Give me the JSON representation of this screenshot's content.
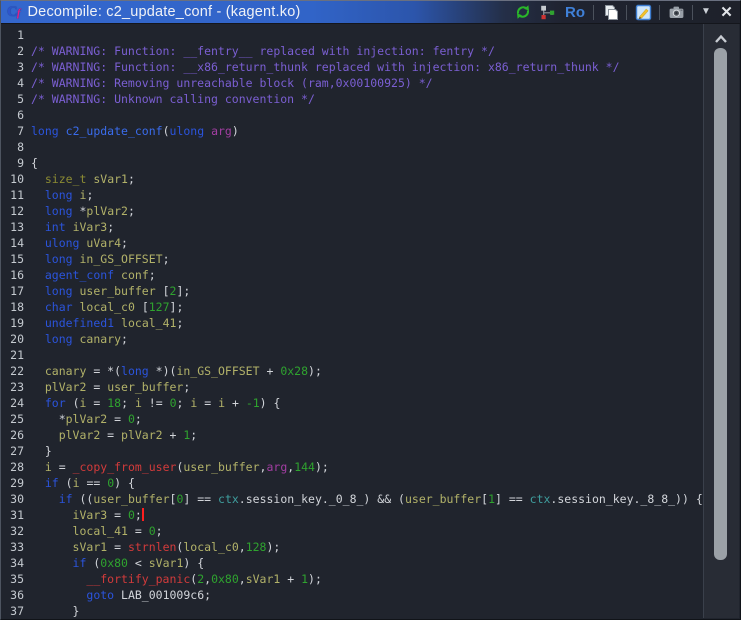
{
  "window": {
    "title": "Decompile: c2_update_conf - (kagent.ko)",
    "decompiler_icon": {
      "letter": "C",
      "sub": "f"
    },
    "toolbar": {
      "ro_label": "Ro",
      "dropdown_glyph": "▼",
      "close_glyph": "✕",
      "icons": [
        "refresh-icon",
        "graph-icon",
        "ro-label",
        "copy-icon",
        "edit-icon",
        "snapshot-icon",
        "dropdown-arrow-icon",
        "close-icon"
      ]
    }
  },
  "colors": {
    "titlebar_accent": "#3164c8",
    "editor_background": "#20242d",
    "comment": "#7b5fd3",
    "keyword_type": "#2b54dc",
    "function_name": "#3a6cec",
    "variable": "#b2b269",
    "constant": "#2fa32f",
    "parameter": "#a23ea2",
    "global": "#3f9f9f",
    "call": "#d23b3b",
    "caret": "#ff1f1f",
    "refresh_green": "#2ab62a"
  },
  "editor": {
    "lines": [
      {
        "n": "1",
        "seg": []
      },
      {
        "n": "2",
        "seg": [
          [
            "cm",
            "/* WARNING: Function: __fentry__ replaced with injection: fentry */"
          ]
        ]
      },
      {
        "n": "3",
        "seg": [
          [
            "cm",
            "/* WARNING: Function: __x86_return_thunk replaced with injection: x86_return_thunk */"
          ]
        ]
      },
      {
        "n": "4",
        "seg": [
          [
            "cm",
            "/* WARNING: Removing unreachable block (ram,0x00100925) */"
          ]
        ]
      },
      {
        "n": "5",
        "seg": [
          [
            "cm",
            "/* WARNING: Unknown calling convention */"
          ]
        ]
      },
      {
        "n": "6",
        "seg": []
      },
      {
        "n": "7",
        "seg": [
          [
            "kw",
            "long"
          ],
          [
            "df",
            " "
          ],
          [
            "fn",
            "c2_update_conf"
          ],
          [
            "df",
            "("
          ],
          [
            "kw",
            "ulong"
          ],
          [
            "df",
            " "
          ],
          [
            "par",
            "arg"
          ],
          [
            "df",
            ")"
          ]
        ]
      },
      {
        "n": "8",
        "seg": []
      },
      {
        "n": "9",
        "seg": [
          [
            "df",
            "{"
          ]
        ]
      },
      {
        "n": "10",
        "seg": [
          [
            "df",
            "  "
          ],
          [
            "t2",
            "size_t"
          ],
          [
            "df",
            " "
          ],
          [
            "var",
            "sVar1"
          ],
          [
            "df",
            ";"
          ]
        ]
      },
      {
        "n": "11",
        "seg": [
          [
            "df",
            "  "
          ],
          [
            "kw",
            "long"
          ],
          [
            "df",
            " "
          ],
          [
            "var",
            "i"
          ],
          [
            "df",
            ";"
          ]
        ]
      },
      {
        "n": "12",
        "seg": [
          [
            "df",
            "  "
          ],
          [
            "kw",
            "long"
          ],
          [
            "df",
            " *"
          ],
          [
            "var",
            "plVar2"
          ],
          [
            "df",
            ";"
          ]
        ]
      },
      {
        "n": "13",
        "seg": [
          [
            "df",
            "  "
          ],
          [
            "kw",
            "int"
          ],
          [
            "df",
            " "
          ],
          [
            "var",
            "iVar3"
          ],
          [
            "df",
            ";"
          ]
        ]
      },
      {
        "n": "14",
        "seg": [
          [
            "df",
            "  "
          ],
          [
            "kw",
            "ulong"
          ],
          [
            "df",
            " "
          ],
          [
            "var",
            "uVar4"
          ],
          [
            "df",
            ";"
          ]
        ]
      },
      {
        "n": "15",
        "seg": [
          [
            "df",
            "  "
          ],
          [
            "kw",
            "long"
          ],
          [
            "df",
            " "
          ],
          [
            "var",
            "in_GS_OFFSET"
          ],
          [
            "df",
            ";"
          ]
        ]
      },
      {
        "n": "16",
        "seg": [
          [
            "df",
            "  "
          ],
          [
            "kw",
            "agent_conf"
          ],
          [
            "df",
            " "
          ],
          [
            "var",
            "conf"
          ],
          [
            "df",
            ";"
          ]
        ]
      },
      {
        "n": "17",
        "seg": [
          [
            "df",
            "  "
          ],
          [
            "kw",
            "long"
          ],
          [
            "df",
            " "
          ],
          [
            "var",
            "user_buffer"
          ],
          [
            "df",
            " ["
          ],
          [
            "num",
            "2"
          ],
          [
            "df",
            "];"
          ]
        ]
      },
      {
        "n": "18",
        "seg": [
          [
            "df",
            "  "
          ],
          [
            "kw",
            "char"
          ],
          [
            "df",
            " "
          ],
          [
            "var",
            "local_c0"
          ],
          [
            "df",
            " ["
          ],
          [
            "num",
            "127"
          ],
          [
            "df",
            "];"
          ]
        ]
      },
      {
        "n": "19",
        "seg": [
          [
            "df",
            "  "
          ],
          [
            "kw",
            "undefined1"
          ],
          [
            "df",
            " "
          ],
          [
            "var",
            "local_41"
          ],
          [
            "df",
            ";"
          ]
        ]
      },
      {
        "n": "20",
        "seg": [
          [
            "df",
            "  "
          ],
          [
            "kw",
            "long"
          ],
          [
            "df",
            " "
          ],
          [
            "var",
            "canary"
          ],
          [
            "df",
            ";"
          ]
        ]
      },
      {
        "n": "21",
        "seg": []
      },
      {
        "n": "22",
        "seg": [
          [
            "df",
            "  "
          ],
          [
            "var",
            "canary"
          ],
          [
            "df",
            " = *("
          ],
          [
            "kw",
            "long"
          ],
          [
            "df",
            " *)("
          ],
          [
            "var",
            "in_GS_OFFSET"
          ],
          [
            "df",
            " + "
          ],
          [
            "num",
            "0x28"
          ],
          [
            "df",
            ");"
          ]
        ]
      },
      {
        "n": "23",
        "seg": [
          [
            "df",
            "  "
          ],
          [
            "var",
            "plVar2"
          ],
          [
            "df",
            " = "
          ],
          [
            "var",
            "user_buffer"
          ],
          [
            "df",
            ";"
          ]
        ]
      },
      {
        "n": "24",
        "seg": [
          [
            "df",
            "  "
          ],
          [
            "kw",
            "for"
          ],
          [
            "df",
            " ("
          ],
          [
            "var",
            "i"
          ],
          [
            "df",
            " = "
          ],
          [
            "num",
            "18"
          ],
          [
            "df",
            "; "
          ],
          [
            "var",
            "i"
          ],
          [
            "df",
            " != "
          ],
          [
            "num",
            "0"
          ],
          [
            "df",
            "; "
          ],
          [
            "var",
            "i"
          ],
          [
            "df",
            " = "
          ],
          [
            "var",
            "i"
          ],
          [
            "df",
            " + "
          ],
          [
            "num",
            "-1"
          ],
          [
            "df",
            ") {"
          ]
        ]
      },
      {
        "n": "25",
        "seg": [
          [
            "df",
            "    *"
          ],
          [
            "var",
            "plVar2"
          ],
          [
            "df",
            " = "
          ],
          [
            "num",
            "0"
          ],
          [
            "df",
            ";"
          ]
        ]
      },
      {
        "n": "26",
        "seg": [
          [
            "df",
            "    "
          ],
          [
            "var",
            "plVar2"
          ],
          [
            "df",
            " = "
          ],
          [
            "var",
            "plVar2"
          ],
          [
            "df",
            " + "
          ],
          [
            "num",
            "1"
          ],
          [
            "df",
            ";"
          ]
        ]
      },
      {
        "n": "27",
        "seg": [
          [
            "df",
            "  }"
          ]
        ]
      },
      {
        "n": "28",
        "seg": [
          [
            "df",
            "  "
          ],
          [
            "var",
            "i"
          ],
          [
            "df",
            " = "
          ],
          [
            "cl",
            "_copy_from_user"
          ],
          [
            "df",
            "("
          ],
          [
            "var",
            "user_buffer"
          ],
          [
            "df",
            ","
          ],
          [
            "par",
            "arg"
          ],
          [
            "df",
            ","
          ],
          [
            "num",
            "144"
          ],
          [
            "df",
            ");"
          ]
        ]
      },
      {
        "n": "29",
        "seg": [
          [
            "df",
            "  "
          ],
          [
            "kw",
            "if"
          ],
          [
            "df",
            " ("
          ],
          [
            "var",
            "i"
          ],
          [
            "df",
            " == "
          ],
          [
            "num",
            "0"
          ],
          [
            "df",
            ") {"
          ]
        ]
      },
      {
        "n": "30",
        "seg": [
          [
            "df",
            "    "
          ],
          [
            "kw",
            "if"
          ],
          [
            "df",
            " (("
          ],
          [
            "var",
            "user_buffer"
          ],
          [
            "df",
            "["
          ],
          [
            "num",
            "0"
          ],
          [
            "df",
            "] == "
          ],
          [
            "gl",
            "ctx"
          ],
          [
            "df",
            ".session_key._0_8_) && ("
          ],
          [
            "var",
            "user_buffer"
          ],
          [
            "df",
            "["
          ],
          [
            "num",
            "1"
          ],
          [
            "df",
            "] == "
          ],
          [
            "gl",
            "ctx"
          ],
          [
            "df",
            ".session_key._8_8_)) {"
          ]
        ]
      },
      {
        "n": "31",
        "seg": [
          [
            "df",
            "      "
          ],
          [
            "var",
            "iVar3"
          ],
          [
            "df",
            " = "
          ],
          [
            "num",
            "0"
          ],
          [
            "df",
            ";"
          ]
        ],
        "cursor": true
      },
      {
        "n": "32",
        "seg": [
          [
            "df",
            "      "
          ],
          [
            "var",
            "local_41"
          ],
          [
            "df",
            " = "
          ],
          [
            "num",
            "0"
          ],
          [
            "df",
            ";"
          ]
        ]
      },
      {
        "n": "33",
        "seg": [
          [
            "df",
            "      "
          ],
          [
            "var",
            "sVar1"
          ],
          [
            "df",
            " = "
          ],
          [
            "cl",
            "strnlen"
          ],
          [
            "df",
            "("
          ],
          [
            "var",
            "local_c0"
          ],
          [
            "df",
            ","
          ],
          [
            "num",
            "128"
          ],
          [
            "df",
            ");"
          ]
        ]
      },
      {
        "n": "34",
        "seg": [
          [
            "df",
            "      "
          ],
          [
            "kw",
            "if"
          ],
          [
            "df",
            " ("
          ],
          [
            "num",
            "0x80"
          ],
          [
            "df",
            " < "
          ],
          [
            "var",
            "sVar1"
          ],
          [
            "df",
            ") {"
          ]
        ]
      },
      {
        "n": "35",
        "seg": [
          [
            "df",
            "        "
          ],
          [
            "cl",
            "__fortify_panic"
          ],
          [
            "df",
            "("
          ],
          [
            "num",
            "2"
          ],
          [
            "df",
            ","
          ],
          [
            "num",
            "0x80"
          ],
          [
            "df",
            ","
          ],
          [
            "var",
            "sVar1"
          ],
          [
            "df",
            " + "
          ],
          [
            "num",
            "1"
          ],
          [
            "df",
            ");"
          ]
        ]
      },
      {
        "n": "36",
        "seg": [
          [
            "df",
            "        "
          ],
          [
            "kw",
            "goto"
          ],
          [
            "df",
            " "
          ],
          [
            "lab",
            "LAB_001009c6"
          ],
          [
            "df",
            ";"
          ]
        ]
      },
      {
        "n": "37",
        "seg": [
          [
            "df",
            "      }"
          ]
        ]
      }
    ]
  }
}
